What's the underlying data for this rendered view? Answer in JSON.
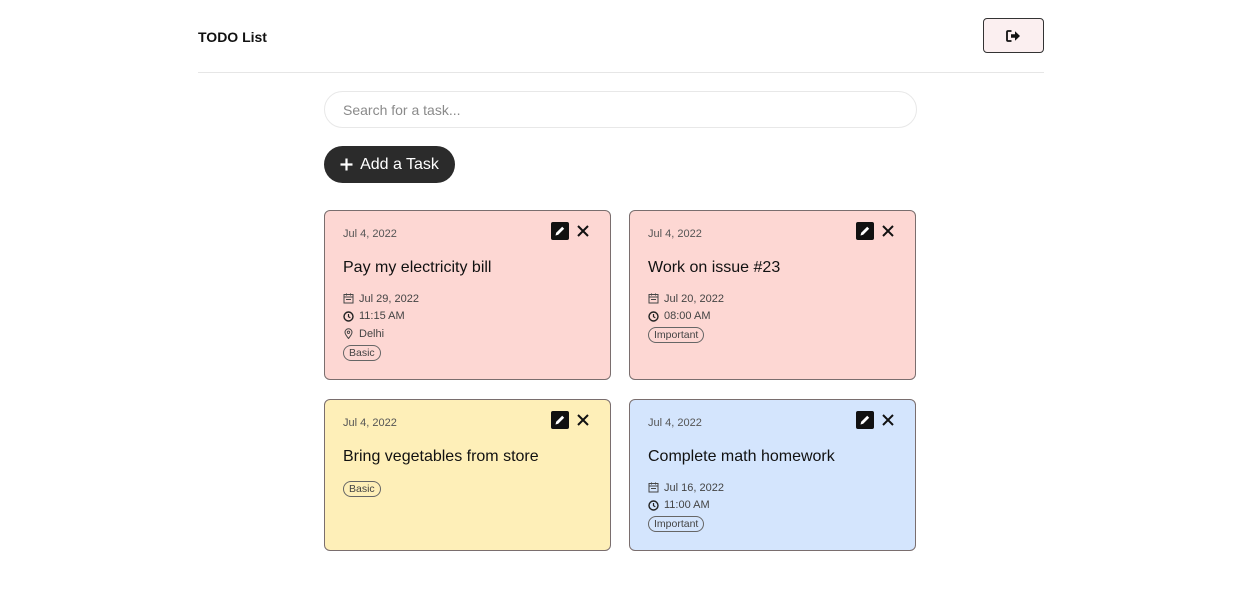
{
  "header": {
    "title": "TODO List",
    "logout_icon": "sign-out-icon"
  },
  "search": {
    "placeholder": "Search for a task..."
  },
  "add_button": {
    "label": "Add a Task",
    "icon": "plus-icon"
  },
  "colors": {
    "pink": "#fdd7d3",
    "yellow": "#feefb8",
    "blue": "#d4e5fd",
    "button_dark": "#2b2b2b"
  },
  "tasks": [
    {
      "created": "Jul 4, 2022",
      "title": "Pay my electricity bill",
      "due_date": "Jul 29, 2022",
      "time": "11:15 AM",
      "location": "Delhi",
      "tag": "Basic",
      "color": "pink"
    },
    {
      "created": "Jul 4, 2022",
      "title": "Work on issue #23",
      "due_date": "Jul 20, 2022",
      "time": "08:00 AM",
      "tag": "Important",
      "color": "pink"
    },
    {
      "created": "Jul 4, 2022",
      "title": "Bring vegetables from store",
      "tag": "Basic",
      "color": "yellow"
    },
    {
      "created": "Jul 4, 2022",
      "title": "Complete math homework",
      "due_date": "Jul 16, 2022",
      "time": "11:00 AM",
      "tag": "Important",
      "color": "blue"
    }
  ]
}
